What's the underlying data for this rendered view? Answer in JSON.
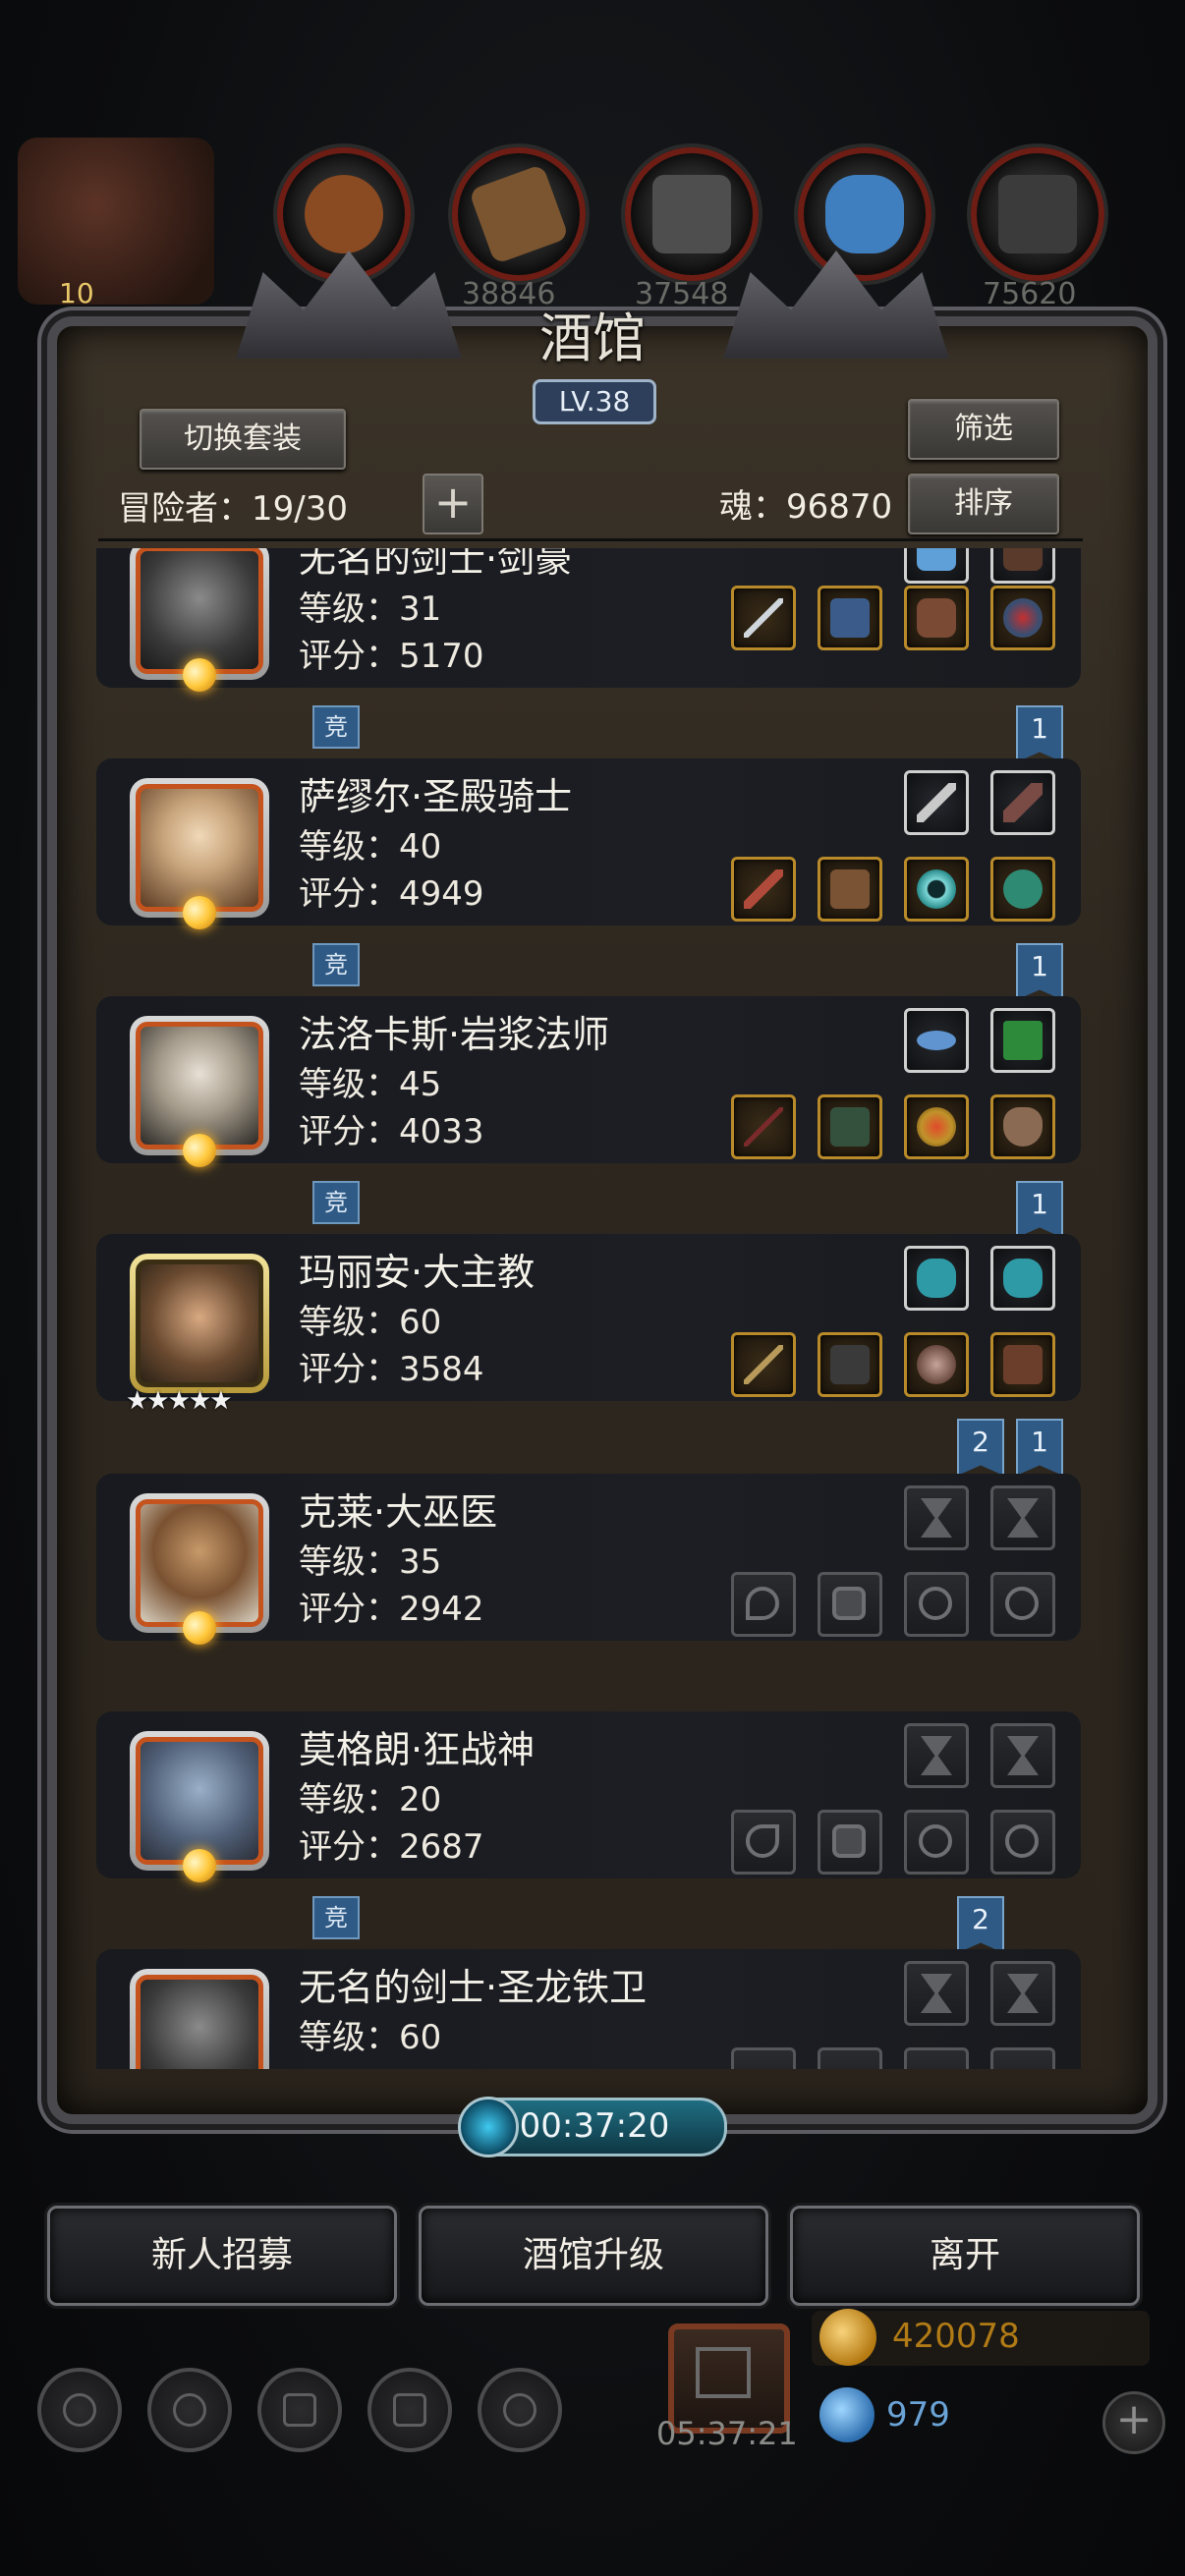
{
  "resources": [
    {
      "icon": "wood-log-icon",
      "value": "",
      "color": "#8a4a22"
    },
    {
      "icon": "plank-icon",
      "value": "38846",
      "color": "#7a5530"
    },
    {
      "icon": "stone-icon",
      "value": "37548",
      "color": "#4e4e4e"
    },
    {
      "icon": "crystal-icon",
      "value": "",
      "color": "#3f7fc0"
    },
    {
      "icon": "iron-icon",
      "value": "75620",
      "color": "#3b3b3b"
    }
  ],
  "event_badge": "10",
  "panel": {
    "title": "酒馆",
    "level": "LV.38",
    "switch_outfit": "切换套装",
    "filter": "筛选",
    "sort": "排序",
    "adventurers_label": "冒险者：19/30",
    "soul_label": "魂：96870",
    "add_symbol": "+"
  },
  "heroes": [
    {
      "name": "无名的剑士·剑豪",
      "level": "等级：31",
      "score": "评分：5170",
      "portrait": "helmet",
      "jing": "竞",
      "rank": [
        "1"
      ]
    },
    {
      "name": "萨缪尔·圣殿骑士",
      "level": "等级：40",
      "score": "评分：4949",
      "portrait": "blond",
      "jing": "竞",
      "rank": [
        "1"
      ]
    },
    {
      "name": "法洛卡斯·岩浆法师",
      "level": "等级：45",
      "score": "评分：4033",
      "portrait": "elf",
      "jing": "竞",
      "rank": [
        "1"
      ]
    },
    {
      "name": "玛丽安·大主教",
      "level": "等级：60",
      "score": "评分：3584",
      "portrait": "nun",
      "stars": "★★★★★",
      "jing": "",
      "rank": [
        "2",
        "1"
      ]
    },
    {
      "name": "克莱·大巫医",
      "level": "等级：35",
      "score": "评分：2942",
      "portrait": "elder",
      "jing": "",
      "rank": []
    },
    {
      "name": "莫格朗·狂战神",
      "level": "等级：20",
      "score": "评分：2687",
      "portrait": "orc",
      "jing": "竞",
      "rank": [
        "2"
      ]
    },
    {
      "name": "无名的剑士·圣龙铁卫",
      "level": "等级：60",
      "score": "",
      "portrait": "helmet",
      "jing": "",
      "rank": []
    }
  ],
  "timer": "00:37:20",
  "actions": {
    "recruit": "新人招募",
    "upgrade": "酒馆升级",
    "leave": "离开"
  },
  "bottom": {
    "gift_time": "05:37:21",
    "gold": "420078",
    "gems": "979",
    "plus": "+"
  }
}
